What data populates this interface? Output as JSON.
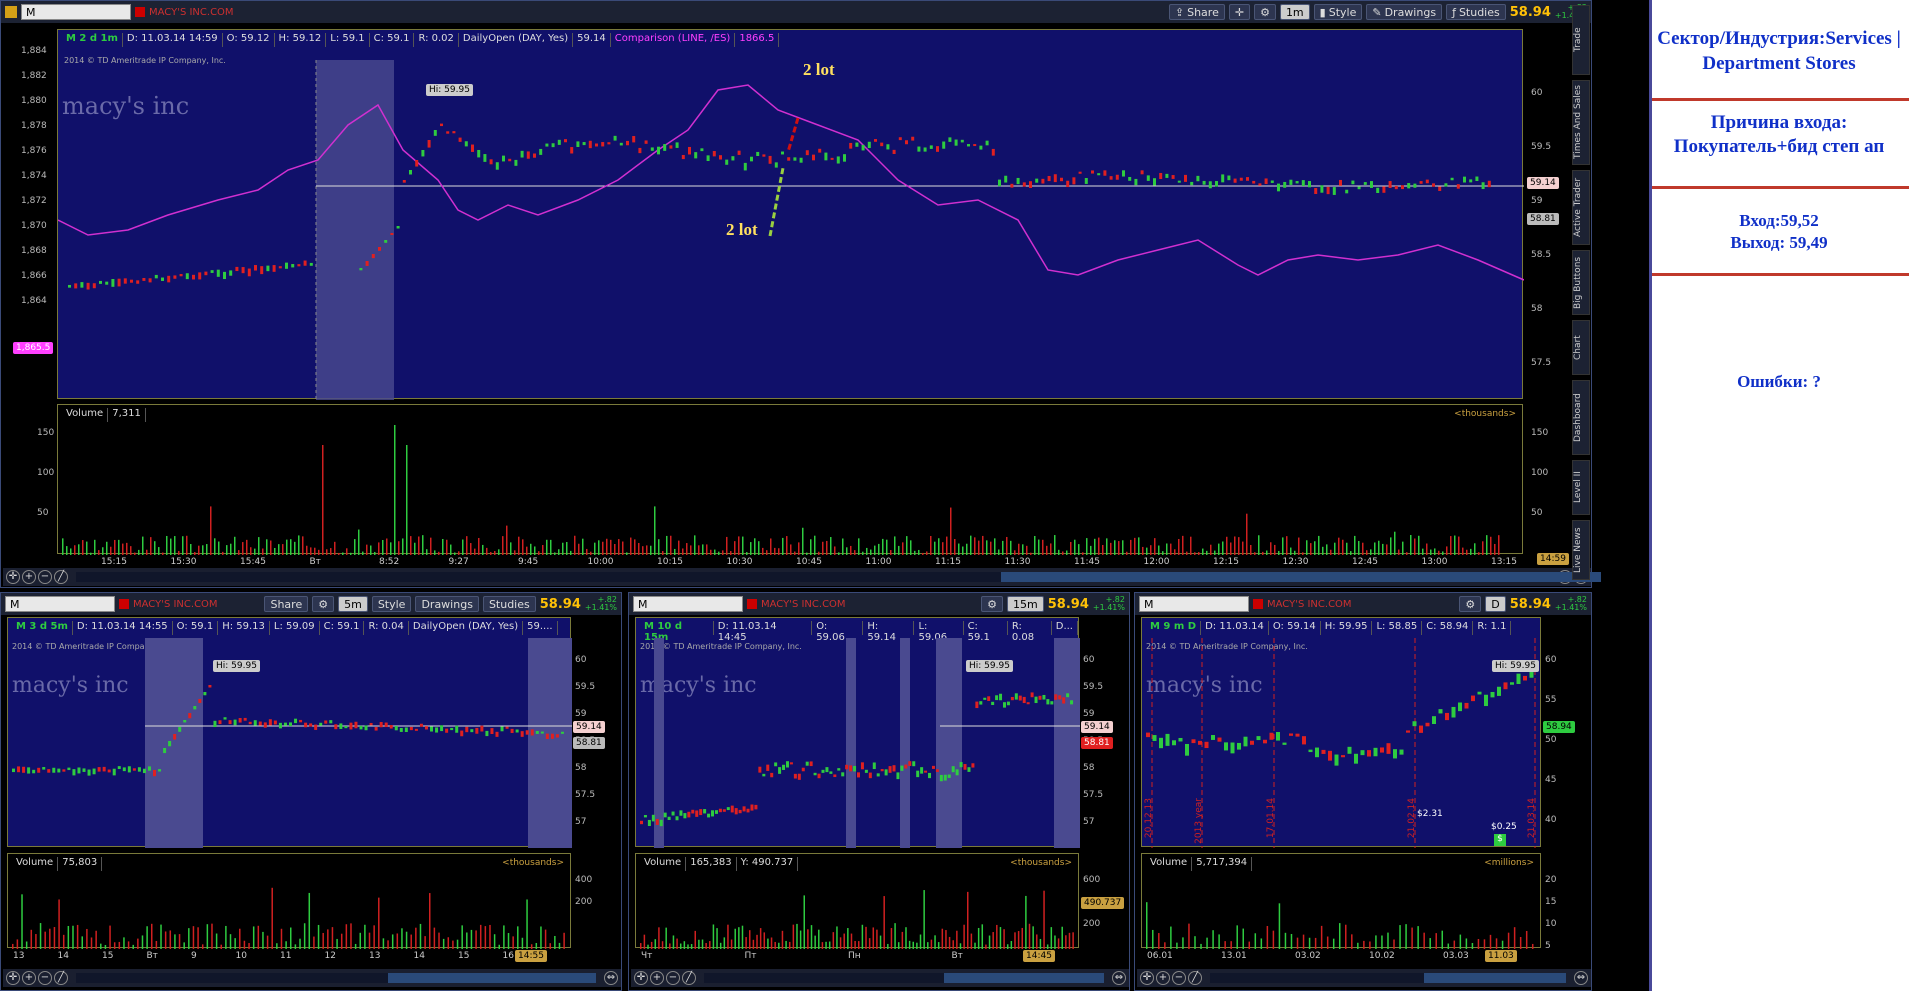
{
  "colors": {
    "plot_bg": "#10106a",
    "price_up": "#2ecc40",
    "price_down": "#e02020",
    "comparison": "#ff40ff",
    "accent": "#ffc107",
    "side_text": "#1030c8",
    "side_line": "#c0392b"
  },
  "main": {
    "symbol": "M",
    "company": "MACY'S INC.COM",
    "share_label": "Share",
    "interval": "1m",
    "style_label": "Style",
    "drawings_label": "Drawings",
    "studies_label": "Studies",
    "price": "58.94",
    "change": "+.82",
    "change_pct": "+1.41%",
    "header": {
      "period": "M 2 d 1m",
      "date": "D: 11.03.14 14:59",
      "open": "O: 59.12",
      "high": "H: 59.12",
      "low": "L: 59.1",
      "close": "C: 59.1",
      "range": "R: 0.02",
      "study": "DailyOpen (DAY, Yes)",
      "study_val": "59.14",
      "comparison": "Comparison (LINE, /ES)",
      "comparison_val": "1866.5"
    },
    "copyright": "2014 © TD Ameritrade IP Company, Inc.",
    "watermark": "macy's inc",
    "hi_label": "Hi: 59.95",
    "tag_59_14": "59.14",
    "tag_58_81": "58.81",
    "tag_es": "1,865.5",
    "annot_red": "2 lot",
    "annot_green": "2 lot",
    "left_axis": [
      "1,884",
      "1,882",
      "1,880",
      "1,878",
      "1,876",
      "1,874",
      "1,872",
      "1,870",
      "1,868",
      "1,866",
      "1,864"
    ],
    "right_axis": [
      "60",
      "59.5",
      "59",
      "58.5",
      "58",
      "57.5"
    ],
    "volume_label": "Volume",
    "volume_val": "7,311",
    "volume_unit": "<thousands>",
    "vol_axis": [
      "150",
      "100",
      "50"
    ],
    "x_axis": [
      "15:15",
      "15:30",
      "15:45",
      "Вт",
      "8:52",
      "9:27",
      "9:45",
      "10:00",
      "10:15",
      "10:30",
      "10:45",
      "11:00",
      "11:15",
      "11:30",
      "11:45",
      "12:00",
      "12:15",
      "12:30",
      "12:45",
      "13:00",
      "13:15"
    ],
    "time_tag": "14:59",
    "vtabs": [
      "Trade",
      "Times And Sales",
      "Active Trader",
      "Big Buttons",
      "Chart",
      "Dashboard",
      "Level II",
      "Live News"
    ]
  },
  "panel1": {
    "symbol": "M",
    "company": "MACY'S INC.COM",
    "share_label": "Share",
    "interval": "5m",
    "style_label": "Style",
    "drawings_label": "Drawings",
    "studies_label": "Studies",
    "price": "58.94",
    "change": "+.82",
    "change_pct": "+1.41%",
    "header": [
      "M 3 d 5m",
      "D: 11.03.14 14:55",
      "O: 59.1",
      "H: 59.13",
      "L: 59.09",
      "C: 59.1",
      "R: 0.04",
      "DailyOpen (DAY, Yes)",
      "59...."
    ],
    "copyright": "2014 © TD Ameritrade IP Company, Inc.",
    "watermark": "macy's inc",
    "hi_label": "Hi: 59.95",
    "tag_a": "59.14",
    "tag_b": "58.81",
    "right_axis": [
      "60",
      "59.5",
      "59",
      "58.5",
      "58",
      "57.5",
      "57"
    ],
    "volume_label": "Volume",
    "volume_val": "75,803",
    "volume_unit": "<thousands>",
    "vol_axis": [
      "400",
      "200"
    ],
    "x_axis": [
      "13",
      "14",
      "15",
      "Вт",
      "9",
      "10",
      "11",
      "12",
      "13",
      "14",
      "15",
      "16"
    ],
    "time_tag": "14:55"
  },
  "panel2": {
    "symbol": "M",
    "company": "MACY'S INC.COM",
    "interval": "15m",
    "price": "58.94",
    "change": "+.82",
    "change_pct": "+1.41%",
    "header": [
      "M 10 d 15m",
      "D: 11.03.14 14:45",
      "O: 59.06",
      "H: 59.14",
      "L: 59.06",
      "C: 59.1",
      "R: 0.08",
      "D..."
    ],
    "copyright": "2014 © TD Ameritrade IP Company, Inc.",
    "watermark": "macy's inc",
    "hi_label": "Hi: 59.95",
    "tag_a": "59.14",
    "tag_b": "58.81",
    "right_axis": [
      "60",
      "59.5",
      "59",
      "58.5",
      "58",
      "57.5",
      "57"
    ],
    "volume_label": "Volume",
    "volume_val": "165,383",
    "volume_y": "Y: 490.737",
    "volume_unit": "<thousands>",
    "vol_axis": [
      "600",
      "400",
      "200"
    ],
    "vol_tag": "490.737",
    "x_axis": [
      "Чт",
      "Пт",
      "Пн",
      "Вт"
    ],
    "time_tag": "14:45"
  },
  "panel3": {
    "symbol": "M",
    "company": "MACY'S INC.COM",
    "interval": "D",
    "price": "58.94",
    "change": "+.82",
    "change_pct": "+1.41%",
    "header": [
      "M 9 m D",
      "D: 11.03.14",
      "O: 59.14",
      "H: 59.95",
      "L: 58.85",
      "C: 58.94",
      "R: 1.1"
    ],
    "copyright": "2014 © TD Ameritrade IP Company, Inc.",
    "watermark": "macy's inc",
    "hi_label": "Hi: 59.95",
    "tag_a": "58.94",
    "right_axis": [
      "60",
      "55",
      "50",
      "45",
      "40"
    ],
    "dates": [
      "20.12.13",
      "2013 year",
      "17.01.14",
      "21.02.14",
      "21.03.14"
    ],
    "eps": "$2.31",
    "div": "$0.25",
    "volume_label": "Volume",
    "volume_val": "5,717,394",
    "volume_unit": "<millions>",
    "vol_axis": [
      "20",
      "15",
      "10",
      "5"
    ],
    "x_axis": [
      "06.01",
      "13.01",
      "03.02",
      "10.02",
      "03.03"
    ],
    "time_tag": "11.03"
  },
  "sidebar": {
    "sector": "Сектор/Индустрия:Services | Department Stores",
    "reason_title": "Причина входа:",
    "reason": "Покупатель+бид степ ап",
    "entry": "Вход:59,52",
    "exit": "Выход: 59,49",
    "errors": "Ошибки: ?"
  }
}
